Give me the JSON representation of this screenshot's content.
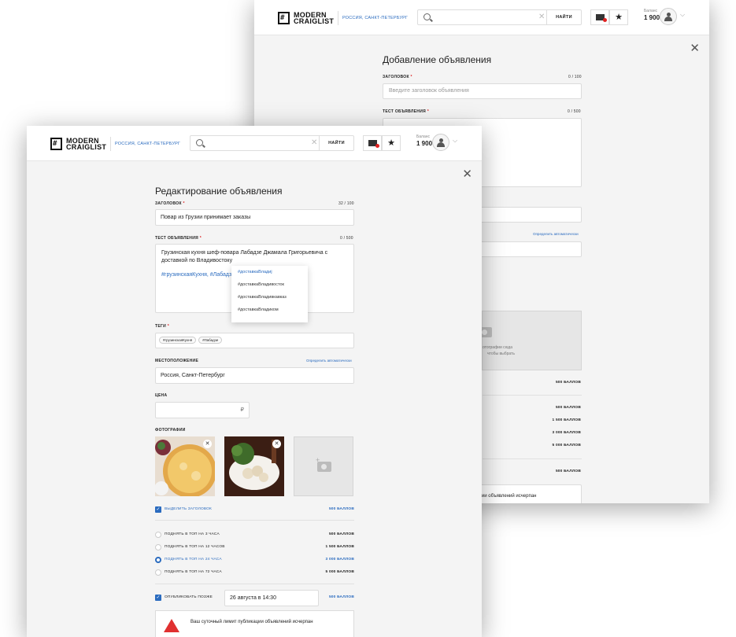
{
  "header": {
    "logo_mark": "#",
    "logo_line1": "MODERN",
    "logo_line2": "CRAIGLIST",
    "location": "РОССИЯ, САНКТ-ПЕТЕРБУРГ",
    "search_button": "НАЙТИ",
    "search_clear": "✕",
    "balance_label": "Баланс",
    "balance_value": "1 900",
    "chevron": "⌵",
    "star": "★",
    "icons": [
      "search-icon",
      "mail-icon",
      "star-icon",
      "user-icon",
      "chevron-down-icon",
      "close-icon"
    ]
  },
  "back": {
    "title": "Добавление объявления",
    "headline_label": "ЗАГОЛОВОК",
    "headline_counter": "0 / 100",
    "headline_placeholder": "Введите заголовок объявления",
    "text_label": "ТЕСТ ОБЪЯВЛЕНИЯ",
    "text_counter": "0 / 500",
    "auto_locate": "Определить автоматически",
    "photo_hint_1": "отографии сюда",
    "photo_hint_2": "чтобы выбрать",
    "prices": [
      "500 БАЛЛОВ",
      "500 БАЛЛОВ",
      "1 500 БАЛЛОВ",
      "3 000 БАЛЛОВ",
      "5 000 БАЛЛОВ",
      "500 БАЛЛОВ"
    ],
    "limit_text": "икации объявлений исчерпан"
  },
  "front": {
    "title": "Редактирование объявления",
    "headline_label": "ЗАГОЛОВОК",
    "headline_counter": "32 / 100",
    "headline_value": "Повар из Грузии принимает заказы",
    "text_label": "ТЕСТ ОБЪЯВЛЕНИЯ",
    "text_counter": "0 / 500",
    "text_value": "Грузинская кухня шеф-повара Лабадзе Джамала Григорьевича с доставкой по Владивостоку",
    "text_hashtags": "#грузинскаяКухня, #Лабадз",
    "autocomplete": [
      "#доставкаВладиј",
      "#доставкаВладивосток",
      "#доставкаВладивкавказ",
      "#доставкаВладиком"
    ],
    "tags_label": "ТЕГИ",
    "tags": [
      "#грузинскаяКухня",
      "#Лабадзе"
    ],
    "location_label": "МЕСТОПОЛОЖЕНИЕ",
    "auto_locate": "Определить автоматически",
    "location_value": "Россия, Санкт-Петербург",
    "price_label": "ЦЕНА",
    "currency": "₽",
    "photos_label": "ФОТОГРАФИИ",
    "photo_remove": "✕",
    "cam_plus": "+",
    "highlight_label": "ВЫДЕЛИТЬ ЗАГОЛОВОК",
    "highlight_price": "500 БАЛЛОВ",
    "top_options": [
      {
        "label": "ПОДНЯТЬ В ТОП НА 3 ЧАСА",
        "price": "500 БАЛЛОВ",
        "selected": false
      },
      {
        "label": "ПОДНЯТЬ В ТОП НА 12 ЧАСОВ",
        "price": "1 500 БАЛЛОВ",
        "selected": false
      },
      {
        "label": "ПОДНЯТЬ В ТОП НА 24 ЧАСА",
        "price": "3 000 БАЛЛОВ",
        "selected": true
      },
      {
        "label": "ПОДНЯТЬ В ТОП НА 72 ЧАСА",
        "price": "5 000 БАЛЛОВ",
        "selected": false
      }
    ],
    "publish_later_label": "ОПУБЛИКОВАТЬ ПОЗЖЕ",
    "publish_date": "26 августа в 14:30",
    "publish_price": "500 БАЛЛОВ",
    "limit_text": "Ваш суточный лимит публикации объявлений исчерпан"
  },
  "colors": {
    "accent": "#2a6bbf",
    "required": "#dd2222",
    "warning": "#e03030"
  }
}
